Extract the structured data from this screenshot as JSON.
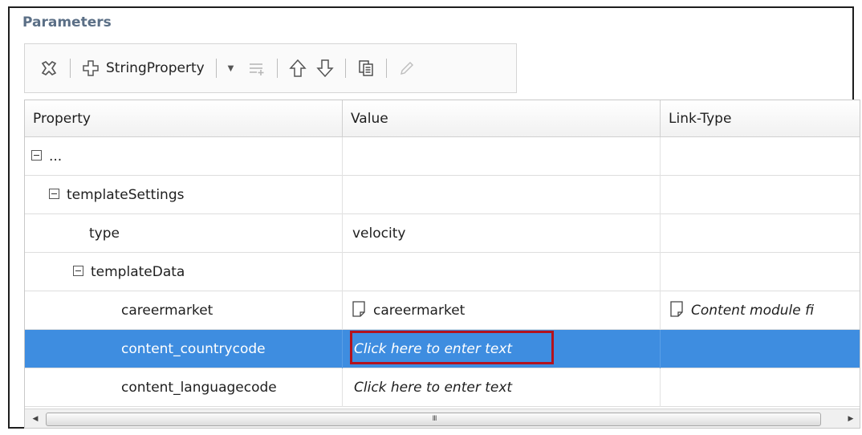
{
  "panel": {
    "title": "Parameters"
  },
  "toolbar": {
    "delete_icon": "delete-icon",
    "add_label": "StringProperty",
    "add_icon": "plus-icon",
    "dropdown_icon": "chevron-down-icon",
    "insert_icon": "insert-row-icon",
    "up_icon": "arrow-up-icon",
    "down_icon": "arrow-down-icon",
    "copy_icon": "copy-icon",
    "edit_icon": "pencil-icon"
  },
  "table": {
    "columns": [
      "Property",
      "Value",
      "Link-Type"
    ],
    "rows": [
      {
        "property": "...",
        "value": "",
        "link": ""
      },
      {
        "property": "templateSettings",
        "value": "",
        "link": ""
      },
      {
        "property": "type",
        "value": "velocity",
        "link": ""
      },
      {
        "property": "templateData",
        "value": "",
        "link": ""
      },
      {
        "property": "careermarket",
        "value": "careermarket",
        "link": "Content module fi"
      },
      {
        "property": "content_countrycode",
        "value": "Click here to enter text",
        "link": ""
      },
      {
        "property": "content_languagecode",
        "value": "Click here to enter text",
        "link": ""
      }
    ]
  },
  "scrollbar": {
    "grip": "III"
  },
  "colors": {
    "selection": "#3e8de0",
    "title": "#5b6f86",
    "highlight_border": "#b3121d"
  }
}
